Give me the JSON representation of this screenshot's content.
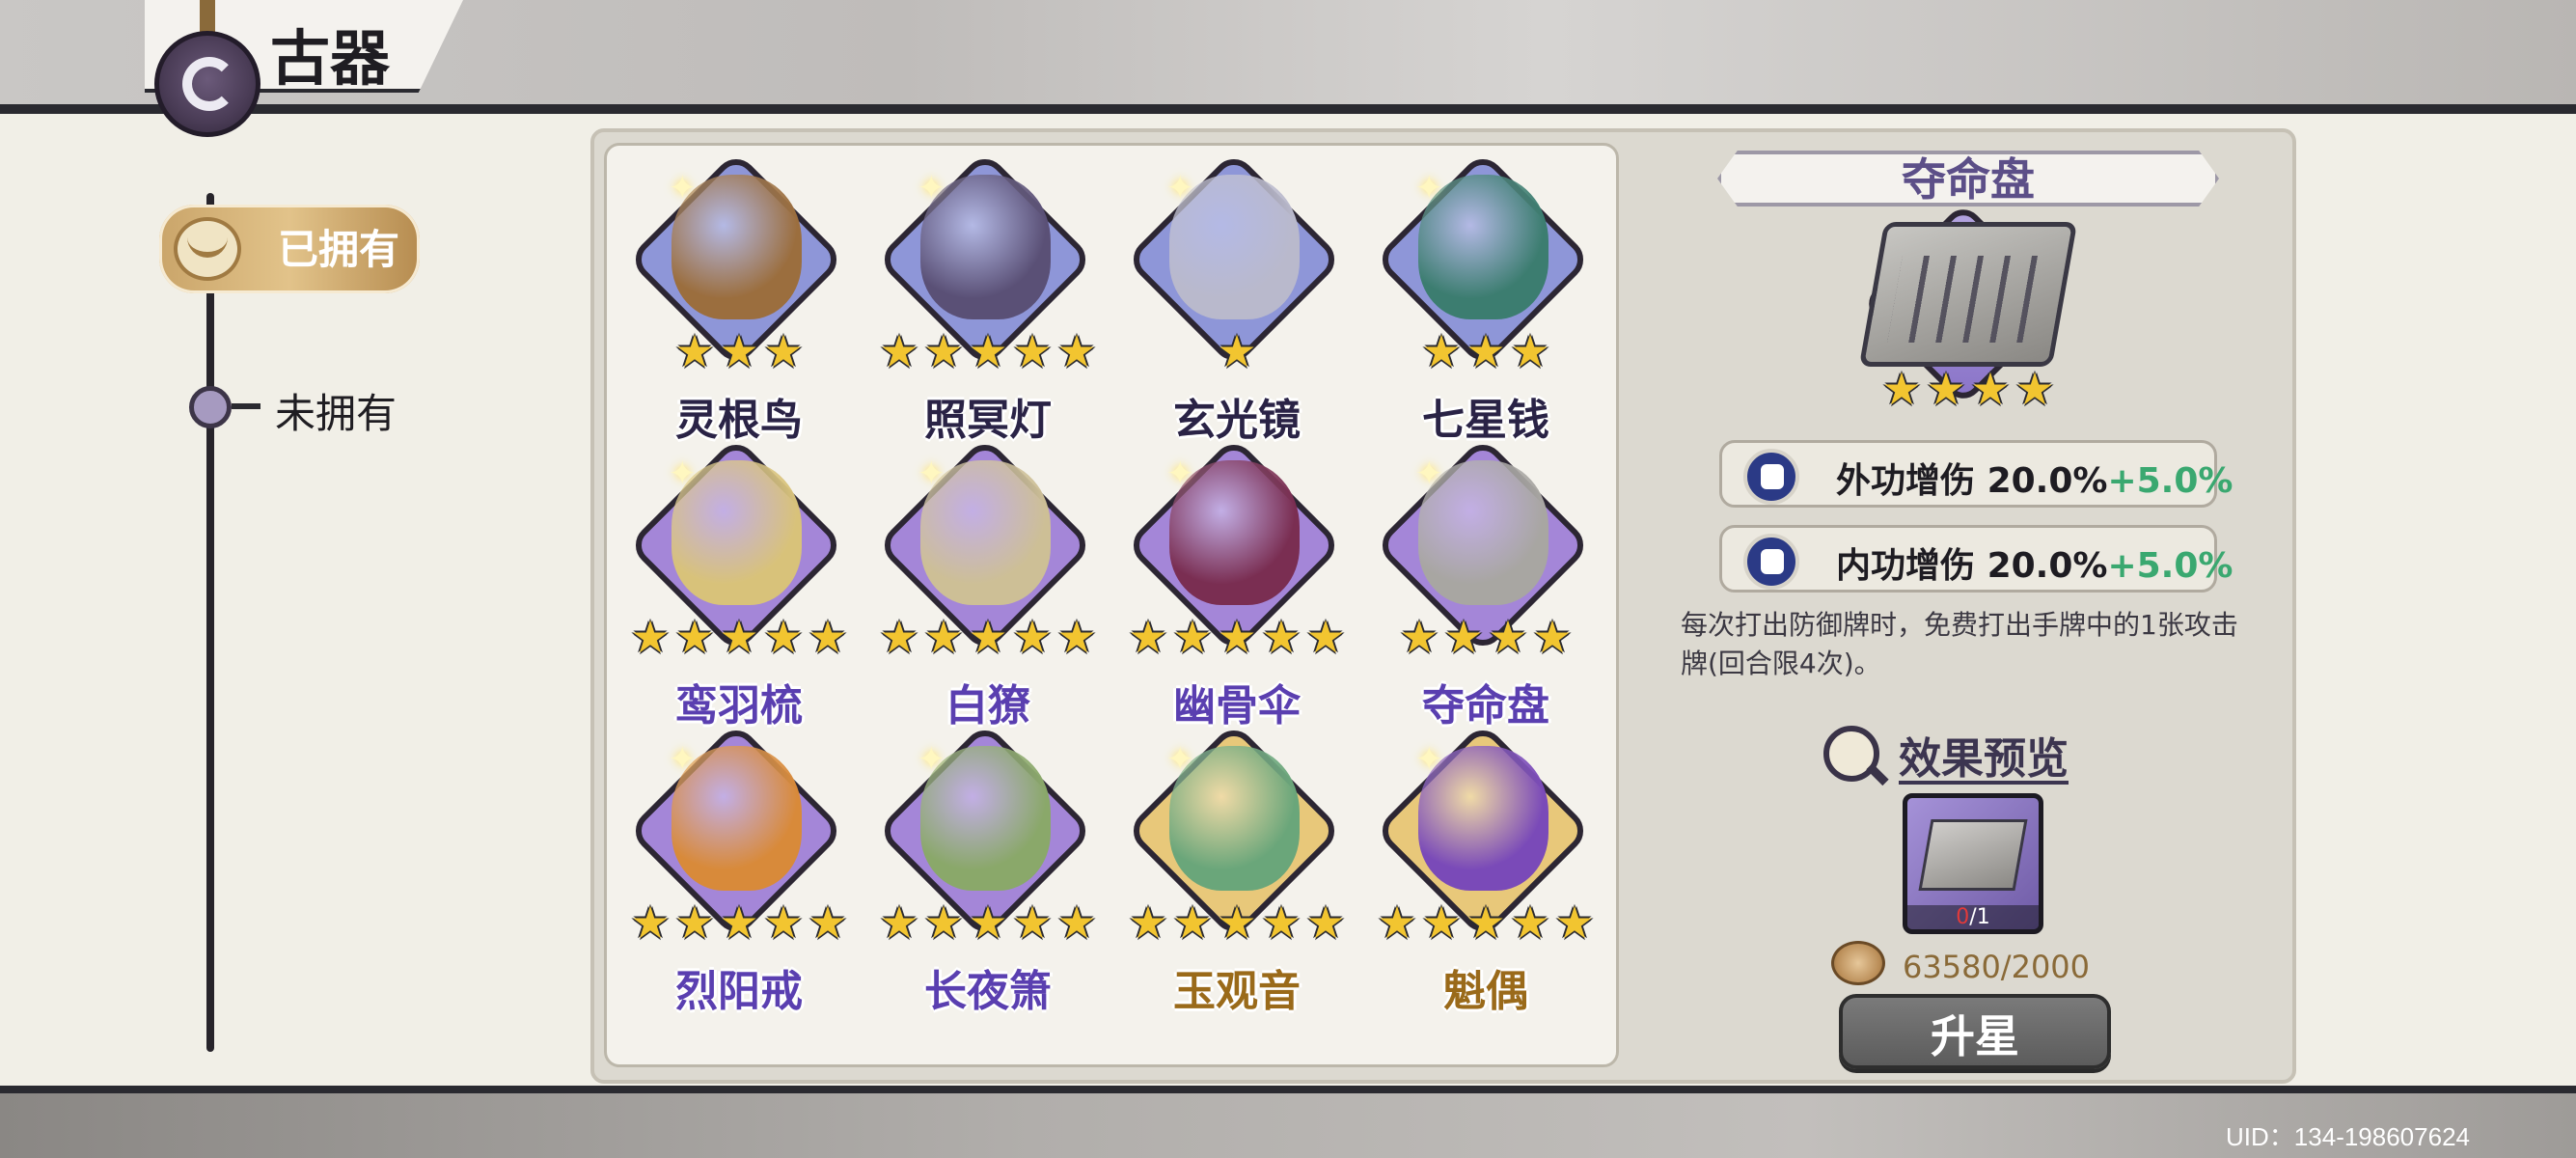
{
  "header": {
    "title": "古器"
  },
  "sidebar": {
    "owned_label": "已拥有",
    "unowned_label": "未拥有"
  },
  "grid": {
    "items": [
      {
        "name": "灵根鸟",
        "stars": 3,
        "name_color": "#2a2346",
        "bg": "#8e96d8",
        "art": "#9b6e3e"
      },
      {
        "name": "照冥灯",
        "stars": 5,
        "name_color": "#2a2346",
        "bg": "#8e96d8",
        "art": "#5a5076"
      },
      {
        "name": "玄光镜",
        "stars": 1,
        "name_color": "#2a2346",
        "bg": "#8e96d8",
        "art": "#b9b9cc"
      },
      {
        "name": "七星钱",
        "stars": 3,
        "name_color": "#2a2346",
        "bg": "#8e96d8",
        "art": "#3c7d70"
      },
      {
        "name": "鸾羽梳",
        "stars": 5,
        "name_color": "#5a3fb0",
        "bg": "#a486d8",
        "art": "#d8c27a"
      },
      {
        "name": "白獠",
        "stars": 5,
        "name_color": "#5a3fb0",
        "bg": "#a486d8",
        "art": "#cdbf96"
      },
      {
        "name": "幽骨伞",
        "stars": 5,
        "name_color": "#5a3fb0",
        "bg": "#a486d8",
        "art": "#7a2e52"
      },
      {
        "name": "夺命盘",
        "stars": 4,
        "name_color": "#5a3fb0",
        "bg": "#a486d8",
        "art": "#a8a6a2"
      },
      {
        "name": "烈阳戒",
        "stars": 5,
        "name_color": "#5a3fb0",
        "bg": "#a486d8",
        "art": "#d88a3a"
      },
      {
        "name": "长夜箫",
        "stars": 5,
        "name_color": "#5a3fb0",
        "bg": "#a486d8",
        "art": "#8aa86a"
      },
      {
        "name": "玉观音",
        "stars": 5,
        "name_color": "#9a6a1a",
        "bg": "#e8c87a",
        "art": "#6aa67a"
      },
      {
        "name": "魁偶",
        "stars": 5,
        "name_color": "#9a6a1a",
        "bg": "#e8c87a",
        "art": "#7a4ab8"
      }
    ]
  },
  "detail": {
    "title": "夺命盘",
    "stars": 4,
    "stats": [
      {
        "label": "外功增伤",
        "value": "20.0%",
        "bonus": "+5.0%"
      },
      {
        "label": "内功增伤",
        "value": "20.0%",
        "bonus": "+5.0%"
      }
    ],
    "description": "每次打出防御牌时，免费打出手牌中的1张攻击牌(回合限4次)。",
    "preview_label": "效果预览",
    "preview_count_current": "0",
    "preview_count_total": "/1",
    "coins": "63580/2000",
    "upgrade_label": "升星"
  },
  "footer": {
    "uid": "UID：134-198607624"
  },
  "colors": {
    "star": "#f2c530",
    "bonus": "#3aa870",
    "accent_purple": "#5c4f88"
  }
}
